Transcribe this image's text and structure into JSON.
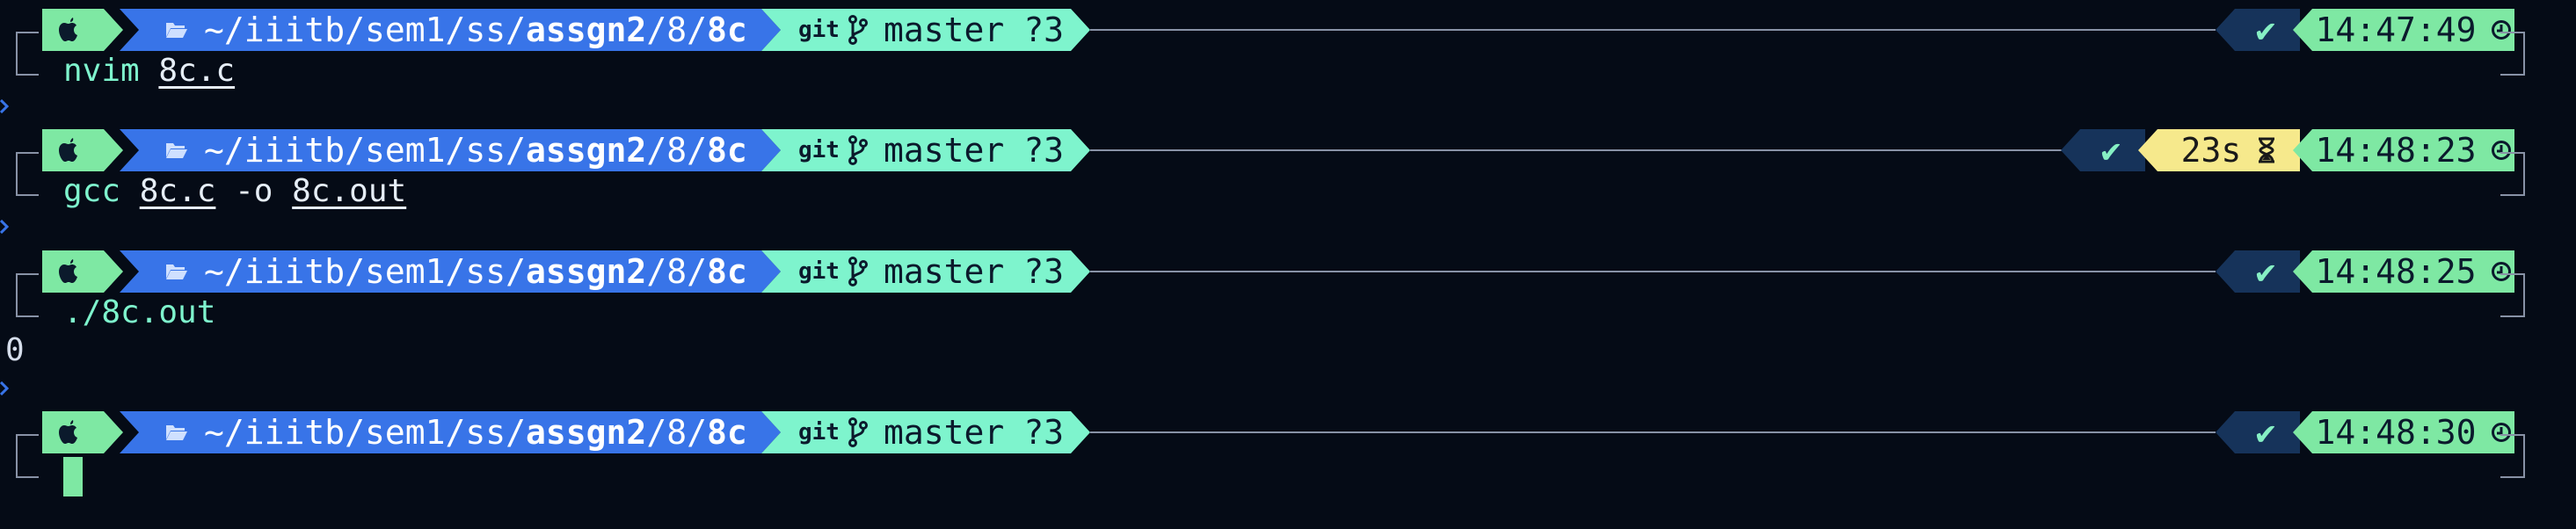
{
  "prompts": [
    {
      "dir_prefix": "~/iiitb/sem1/ss/",
      "dir_bold": "assgn2",
      "dir_mid": "/8/",
      "dir_last": "8c",
      "git_label": "git",
      "branch": "master",
      "git_status": "?3",
      "status_ok": "✔",
      "duration": "",
      "time": "14:47:49",
      "command": "nvim",
      "args": [
        "8c.c"
      ],
      "extra": ""
    },
    {
      "dir_prefix": "~/iiitb/sem1/ss/",
      "dir_bold": "assgn2",
      "dir_mid": "/8/",
      "dir_last": "8c",
      "git_label": "git",
      "branch": "master",
      "git_status": "?3",
      "status_ok": "✔",
      "duration": "23s",
      "time": "14:48:23",
      "command": "gcc",
      "args": [
        "8c.c",
        "8c.out"
      ],
      "extra": "-o"
    },
    {
      "dir_prefix": "~/iiitb/sem1/ss/",
      "dir_bold": "assgn2",
      "dir_mid": "/8/",
      "dir_last": "8c",
      "git_label": "git",
      "branch": "master",
      "git_status": "?3",
      "status_ok": "✔",
      "duration": "",
      "time": "14:48:25",
      "command": "./8c.out",
      "args": [],
      "extra": ""
    },
    {
      "dir_prefix": "~/iiitb/sem1/ss/",
      "dir_bold": "assgn2",
      "dir_mid": "/8/",
      "dir_last": "8c",
      "git_label": "git",
      "branch": "master",
      "git_status": "?3",
      "status_ok": "✔",
      "duration": "",
      "time": "14:48:30",
      "command": "",
      "args": [],
      "extra": ""
    }
  ],
  "output": {
    "program_output": "0"
  },
  "icons": {
    "os": "apple-icon",
    "folder": "folder-open-icon",
    "branch": "git-branch-icon",
    "hourglass": "hourglass-icon",
    "clock": "clock-icon",
    "prompt_chevron": "chevron-right-icon"
  },
  "colors": {
    "background": "#050b16",
    "os_segment": "#7ee8a3",
    "dir_segment": "#3874e8",
    "git_segment": "#7ef4cd",
    "status_segment": "#16335a",
    "duration_segment": "#f6e98c",
    "time_segment": "#7ee8a3",
    "command": "#7ef4cd",
    "chevron": "#3874e8"
  }
}
